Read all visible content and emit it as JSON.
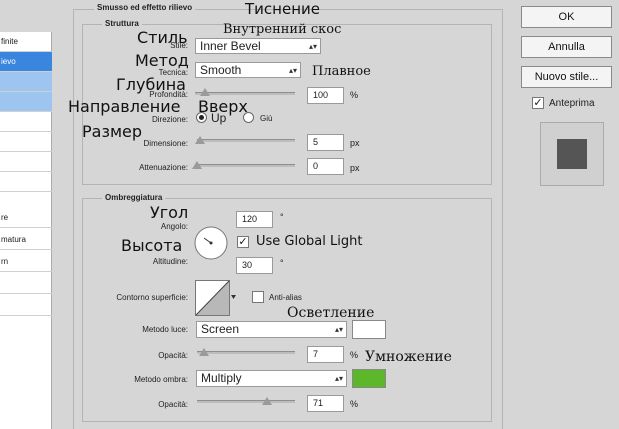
{
  "window": {
    "panel_title": "Smusso ed effetto rilievo",
    "structure_title": "Struttura",
    "shading_title": "Ombreggiatura"
  },
  "left_list": {
    "items": [
      "finite",
      "ievo",
      "",
      "",
      "",
      "",
      "",
      "",
      "re",
      "matura",
      "rn",
      "",
      ""
    ]
  },
  "buttons": {
    "ok": "OK",
    "cancel": "Annulla",
    "new_style": "Nuovo stile...",
    "preview_label": "Anteprima",
    "preview_checked": true
  },
  "structure": {
    "style_label": "Stile:",
    "style_value": "Inner Bevel",
    "technique_label": "Tecnica:",
    "technique_value": "Smooth",
    "depth_label": "Profondità:",
    "depth_value": "100",
    "depth_unit": "%",
    "depth_fraction": 0.1,
    "direction_label": "Direzione:",
    "direction_up": "Up",
    "direction_down": "Giù",
    "direction_selected": "Up",
    "size_label": "Dimensione:",
    "size_value": "5",
    "size_unit": "px",
    "size_fraction": 0.03,
    "soften_label": "Attenuazione:",
    "soften_value": "0",
    "soften_unit": "px",
    "soften_fraction": 0.0
  },
  "shading": {
    "angle_label": "Angolo:",
    "angle_value": "120",
    "angle_unit": "°",
    "global_light_label": "Use Global Light",
    "global_light_checked": true,
    "altitude_label": "Altitudine:",
    "altitude_value": "30",
    "altitude_unit": "°",
    "gloss_contour_label": "Contorno superficie:",
    "antialias_label": "Anti-alias",
    "antialias_checked": false,
    "highlight_mode_label": "Metodo luce:",
    "highlight_mode_value": "Screen",
    "highlight_color": "#ffffff",
    "highlight_opacity_label": "Opacità:",
    "highlight_opacity_value": "7",
    "highlight_opacity_unit": "%",
    "highlight_opacity_fraction": 0.07,
    "shadow_mode_label": "Metodo ombra:",
    "shadow_mode_value": "Multiply",
    "shadow_color": "#5cb82a",
    "shadow_opacity_label": "Opacità:",
    "shadow_opacity_value": "71",
    "shadow_opacity_unit": "%",
    "shadow_opacity_fraction": 0.71
  },
  "annotations": {
    "title_ru": "Тиснение",
    "style_ru": "Стиль",
    "style_value_ru": "Внутренний скос",
    "method_ru": "Метод",
    "smooth_ru": "Плавное",
    "depth_ru": "Глубина",
    "direction_ru": "Направление",
    "up_ru": "Вверх",
    "size_ru": "Размер",
    "angle_ru": "Угол",
    "altitude_ru": "Высота",
    "screen_ru": "Осветление",
    "multiply_ru": "Умножение"
  },
  "colors": {
    "selection_blue": "#3a85dd",
    "light_blue": "#9ec5f0",
    "panel_bg": "#d6d6d6",
    "shadow_swatch": "#5cb82a",
    "preview_square": "#555555"
  }
}
